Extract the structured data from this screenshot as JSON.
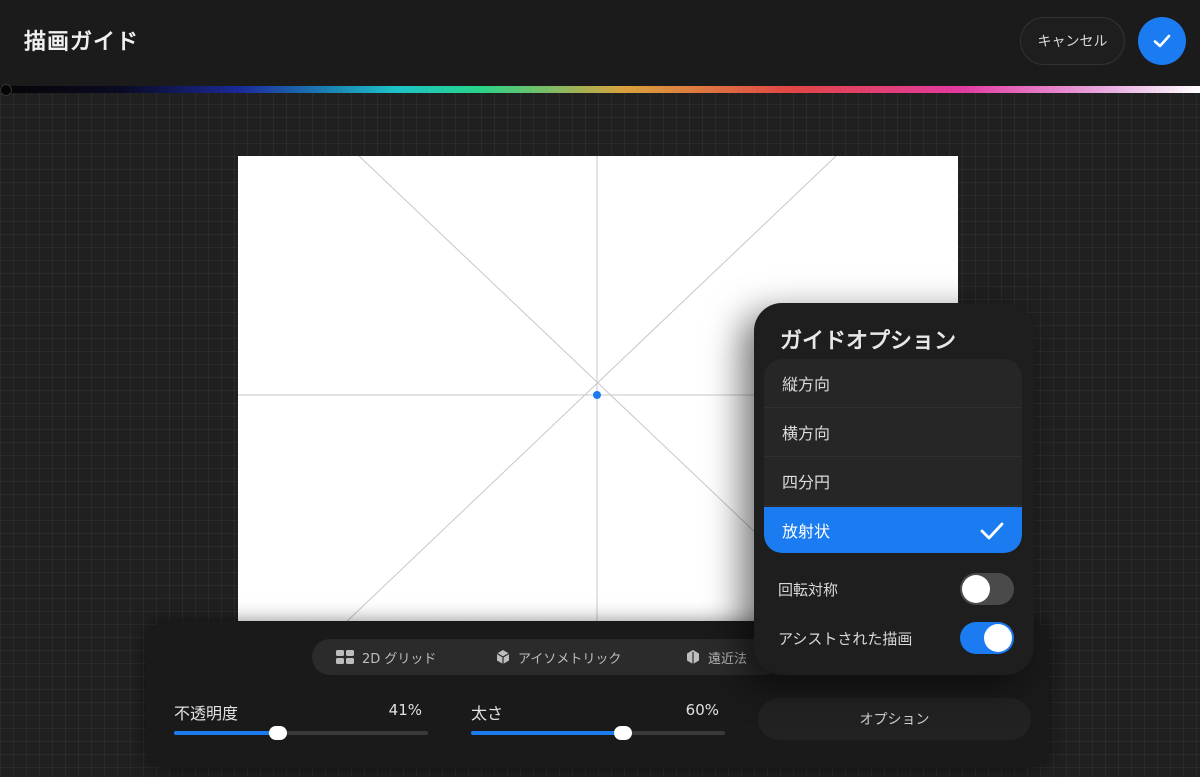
{
  "header": {
    "title": "描画ガイド",
    "cancel_label": "キャンセル",
    "done_icon": "checkmark-icon"
  },
  "guide_modes": [
    {
      "label": "2D グリッド",
      "icon": "grid-icon"
    },
    {
      "label": "アイソメトリック",
      "icon": "isometric-cube-icon"
    },
    {
      "label": "遠近法",
      "icon": "perspective-cube-icon"
    }
  ],
  "sliders": {
    "opacity": {
      "label": "不透明度",
      "value_text": "41%",
      "value": 0.41
    },
    "thickness": {
      "label": "太さ",
      "value_text": "60%",
      "value": 0.6
    }
  },
  "options_button": "オプション",
  "popover": {
    "title": "ガイドオプション",
    "items": [
      {
        "label": "縦方向",
        "selected": false
      },
      {
        "label": "横方向",
        "selected": false
      },
      {
        "label": "四分円",
        "selected": false
      },
      {
        "label": "放射状",
        "selected": true
      }
    ],
    "toggles": [
      {
        "label": "回転対称",
        "on": false
      },
      {
        "label": "アシストされた描画",
        "on": true
      }
    ]
  },
  "colors": {
    "accent": "#1a7cf0",
    "background": "#202020",
    "canvas": "#ffffff"
  }
}
